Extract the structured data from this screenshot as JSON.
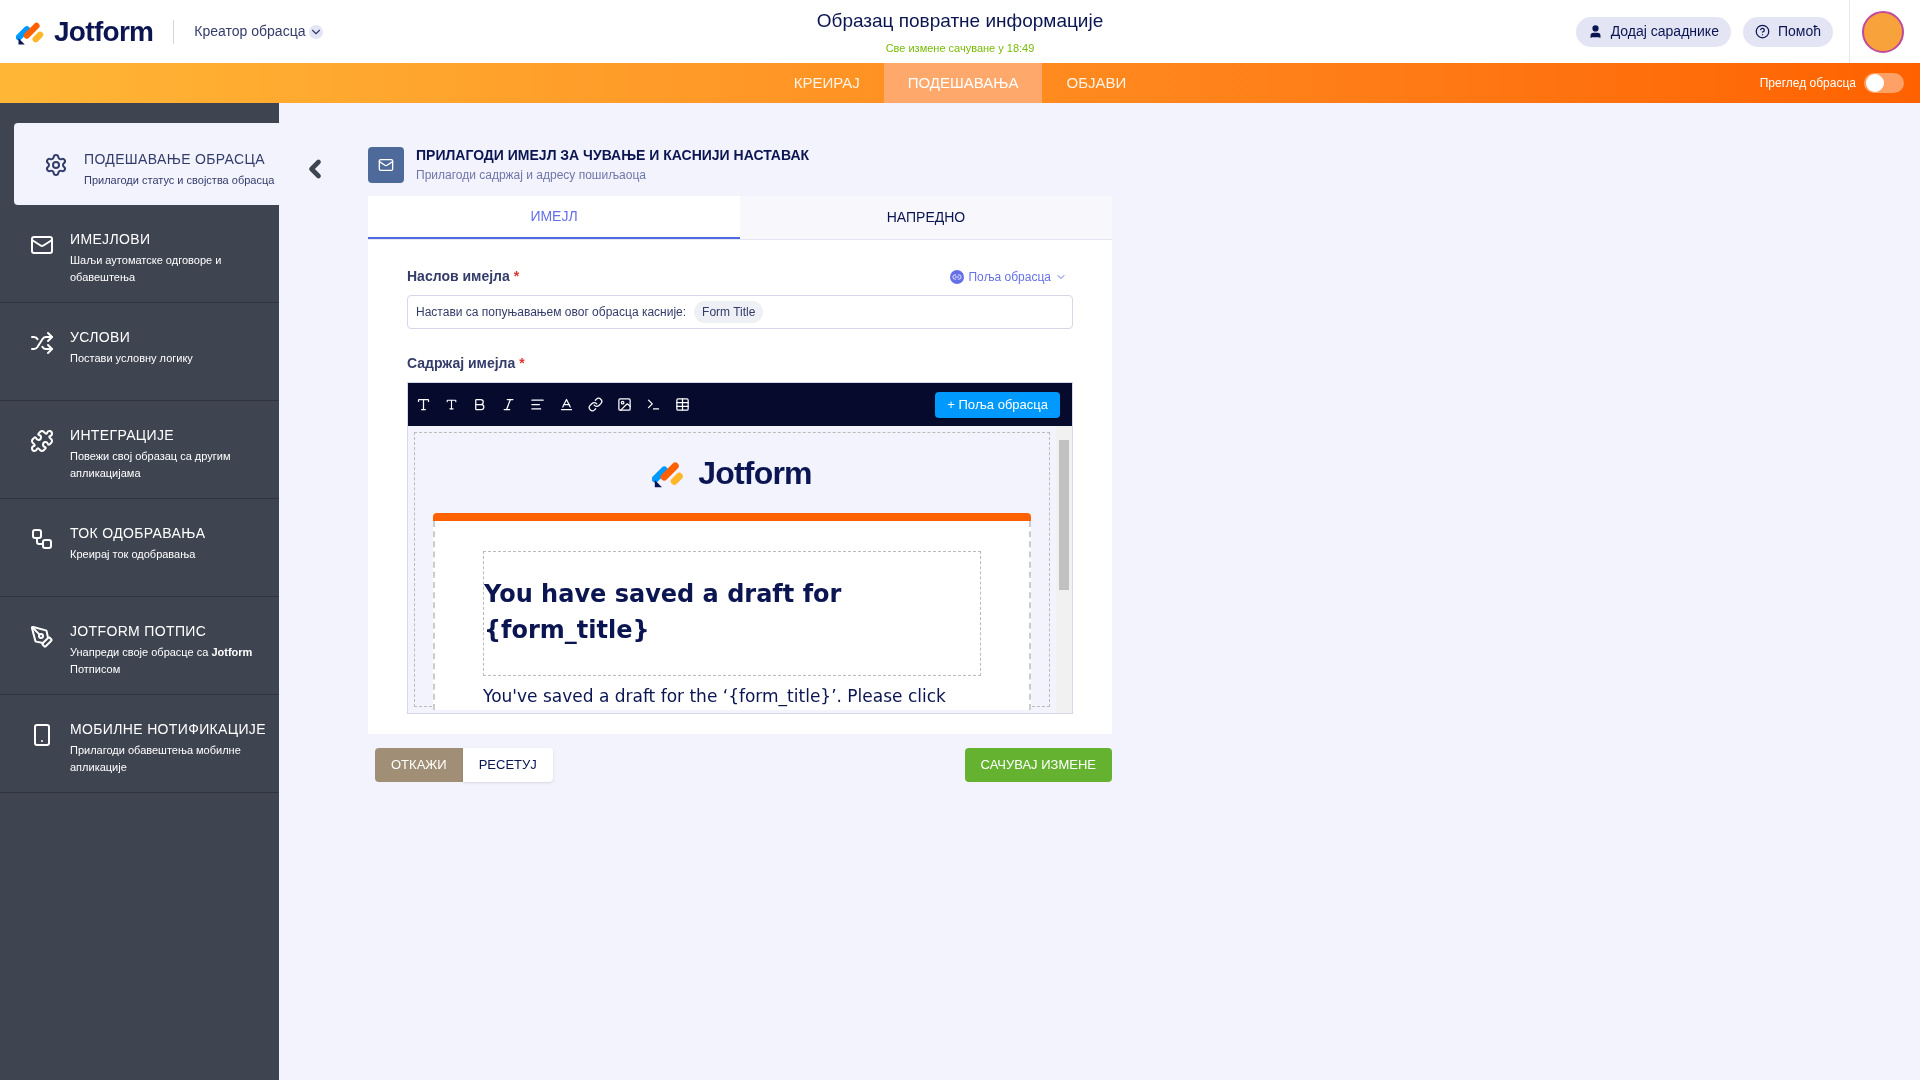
{
  "header": {
    "logo": "Jotform",
    "builder_menu": "Креатор обрасца",
    "title": "Образац повратне информације",
    "saved_status": "Све измене сачуване у 18:49",
    "buttons": [
      {
        "kind": "collaborators",
        "label": "Додај сараднике"
      },
      {
        "kind": "help",
        "label": "Помоћ"
      }
    ]
  },
  "nav": {
    "tabs": [
      {
        "label": "КРЕИРАЈ",
        "selected": false
      },
      {
        "label": "ПОДЕШАВАЊА",
        "selected": true
      },
      {
        "label": "ОБЈАВИ",
        "selected": false
      }
    ],
    "preview": {
      "label": "Преглед обрасца",
      "on": false
    }
  },
  "sidebar": {
    "items": [
      {
        "kind": "settings",
        "title": "ПОДЕШАВАЊЕ ОБРАСЦА",
        "subtitle": "Прилагоди статус и својства обрасца",
        "selected": true
      },
      {
        "kind": "emails",
        "title": "ИМЕЈЛОВИ",
        "subtitle": "Шаљи аутоматске одговоре и обавештења",
        "selected": false
      },
      {
        "kind": "conditions",
        "title": "УСЛОВИ",
        "subtitle": "Постави условну логику",
        "selected": false
      },
      {
        "kind": "integrations",
        "title": "ИНТЕГРАЦИЈЕ",
        "subtitle": "Повежи свој образац са другим апликацијама",
        "selected": false
      },
      {
        "kind": "approval",
        "title": "ТОК ОДОБРАВАЊА",
        "subtitle": "Креирај ток одобравања",
        "selected": false
      },
      {
        "kind": "sign",
        "title": "JOTFORM ПОТПИС",
        "subtitle": "Унапреди своје обрасце са **Jotform** Потписом",
        "selected": false
      },
      {
        "kind": "mobile",
        "title": "МОБИЛНЕ НОТИФИКАЦИЈЕ",
        "subtitle": "Прилагоди обавештења мобилне апликације",
        "selected": false
      }
    ]
  },
  "section": {
    "title": "ПРИЛАГОДИ ИМЕЈЛ ЗА ЧУВАЊЕ И КАСНИЈИ НАСТАВАК",
    "subtitle": "Прилагоди садржај и адресу пошиљаоца",
    "tabs": [
      {
        "label": "ИМЕЈЛ",
        "selected": true
      },
      {
        "label": "НАПРЕДНО",
        "selected": false
      }
    ],
    "subject": {
      "label": "Наслов имејла",
      "required_mark": "*",
      "fields_menu": "Поља обрасца",
      "value": "Настави са попуњавањем овог обрасца касније:",
      "chip": "Form Title"
    },
    "body": {
      "label": "Садржај имејла",
      "required_mark": "*",
      "add_fields": "+ Поља обрасца",
      "preview": {
        "logo": "Jotform",
        "heading": "You have saved a draft for {form_title}",
        "paragraph": "You've saved a draft for the ‘{form_title}’. Please click"
      }
    }
  },
  "footer": {
    "cancel": "ОТКАЖИ",
    "reset": "РЕСЕТУЈ",
    "save": "САЧУВАЈ ИЗМЕНЕ"
  }
}
